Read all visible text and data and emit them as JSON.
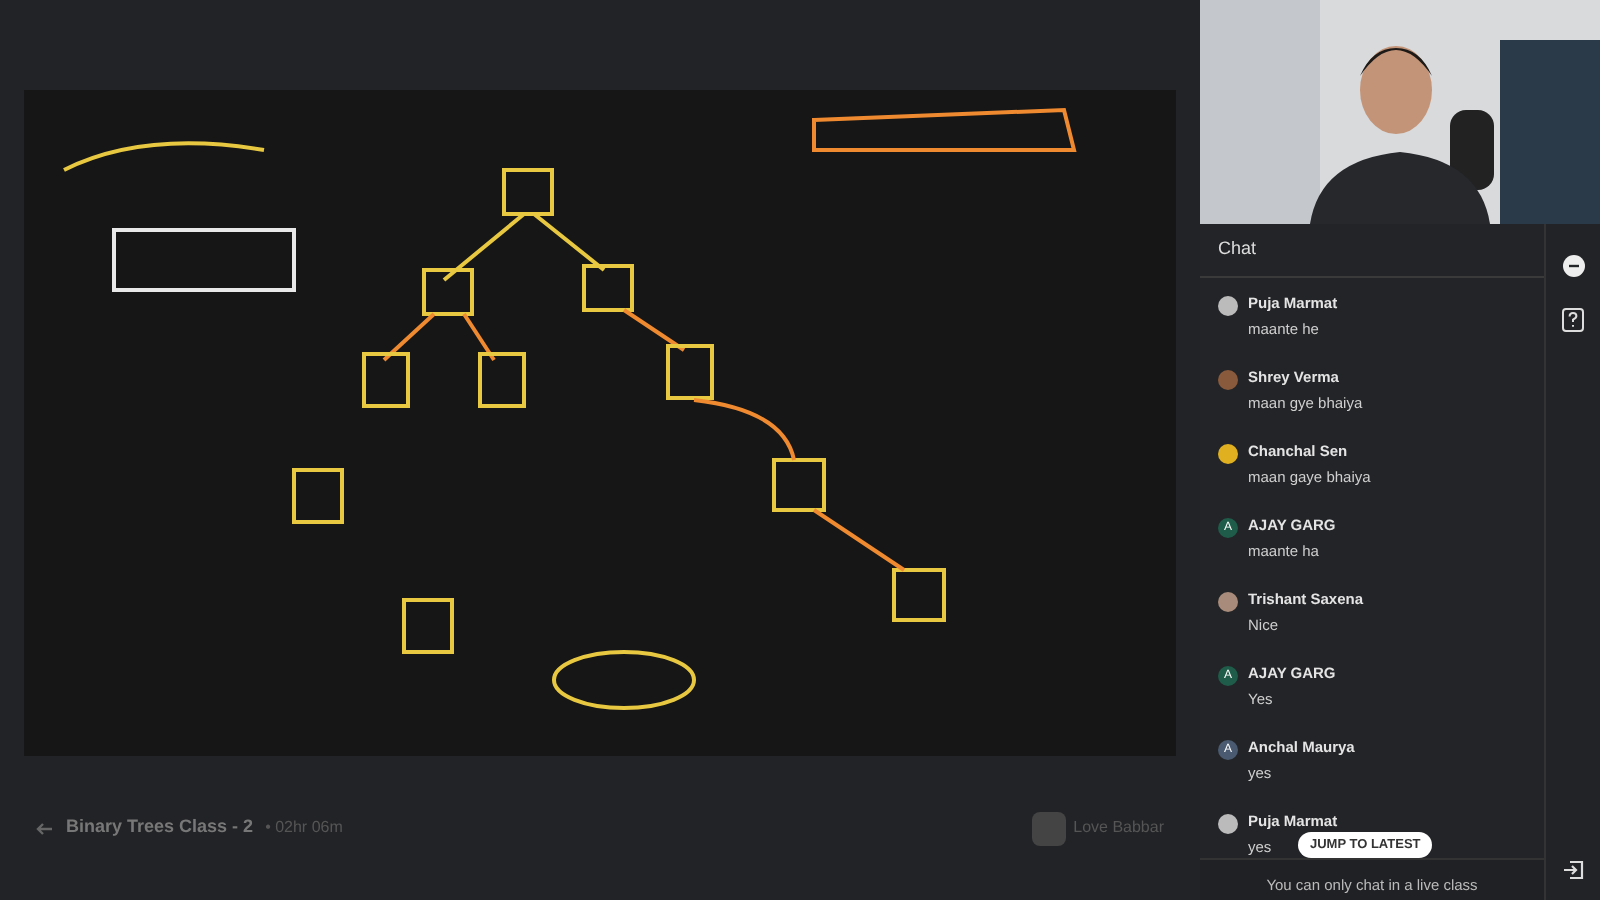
{
  "class_bar": {
    "title": "Binary Trees Class - 2",
    "duration": "• 02hr 06m",
    "educator": "Love Babbar"
  },
  "chat": {
    "title": "Chat",
    "messages": [
      {
        "name": "Puja Marmat",
        "text": "maante he",
        "color": "#bbbbbb"
      },
      {
        "name": "Shrey Verma",
        "text": "maan gye bhaiya",
        "color": "#8a5a3c"
      },
      {
        "name": "Chanchal Sen",
        "text": "maan gaye bhaiya",
        "color": "#e0b020"
      },
      {
        "name": "AJAY GARG",
        "text": "maante ha",
        "kind": "letter",
        "letter": "A",
        "color": "#1f5c4a"
      },
      {
        "name": "Trishant Saxena",
        "text": "Nice",
        "color": "#a88b7a"
      },
      {
        "name": "AJAY GARG",
        "text": "Yes",
        "kind": "letter",
        "letter": "A",
        "color": "#1f5c4a"
      },
      {
        "name": "Anchal Maurya",
        "text": "yes",
        "kind": "letter",
        "letter": "A",
        "color": "#4a5a70"
      },
      {
        "name": "Puja Marmat",
        "text": "yes",
        "color": "#bbbbbb"
      }
    ],
    "jump_button": "JUMP TO LATEST",
    "footer": "You can only chat in a live class"
  }
}
